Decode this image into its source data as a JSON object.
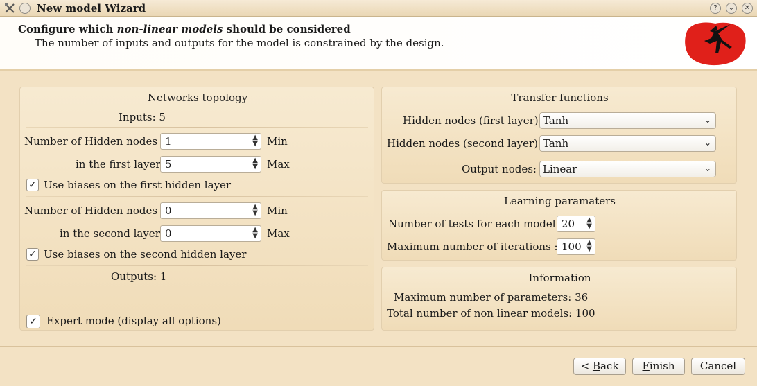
{
  "window": {
    "title": "New model Wizard",
    "help_btn": "?",
    "min_btn": "⌄",
    "close_btn": "✕"
  },
  "header": {
    "line1_pre": "Configure which ",
    "line1_em": "non-linear models",
    "line1_post": " should be considered",
    "line2": "The number of inputs and outputs for the model is constrained by the design."
  },
  "topology": {
    "title": "Networks topology",
    "inputs": "Inputs: 5",
    "first": {
      "label1": "Number of Hidden nodes",
      "label2": "in the first layer",
      "min_value": "1",
      "max_value": "5",
      "min_label": "Min",
      "max_label": "Max",
      "bias_label": "Use biases on the first hidden layer"
    },
    "second": {
      "label1": "Number of Hidden nodes",
      "label2": "in the second layer",
      "min_value": "0",
      "max_value": "0",
      "min_label": "Min",
      "max_label": "Max",
      "bias_label": "Use biases on the second hidden layer"
    },
    "outputs": "Outputs: 1",
    "expert_label": "Expert mode (display all options)"
  },
  "transfer": {
    "title": "Transfer functions",
    "first_label": "Hidden nodes (first layer):",
    "first_value": "Tanh",
    "second_label": "Hidden nodes (second layer):",
    "second_value": "Tanh",
    "output_label": "Output nodes:",
    "output_value": "Linear"
  },
  "learning": {
    "title": "Learning paramaters",
    "tests_label": "Number of tests for each model :",
    "tests_value": "20",
    "iter_label": "Maximum number of iterations :",
    "iter_value": "100"
  },
  "information": {
    "title": "Information",
    "params": "Maximum number of parameters: 36",
    "models": "Total number of non linear models: 100"
  },
  "buttons": {
    "back_pre": "< ",
    "back_key": "B",
    "back_post": "ack",
    "finish_key": "F",
    "finish_post": "inish",
    "cancel": "Cancel"
  },
  "colors": {
    "background": "#f3e2c4",
    "logo_red": "#e0201a"
  },
  "icons": {
    "app": "tools-icon",
    "menu": "window-menu-icon",
    "logo": "ballerina-logo-icon",
    "check": "checkmark-icon",
    "chevron": "chevron-down-icon",
    "spin": "spin-arrows-icon"
  }
}
